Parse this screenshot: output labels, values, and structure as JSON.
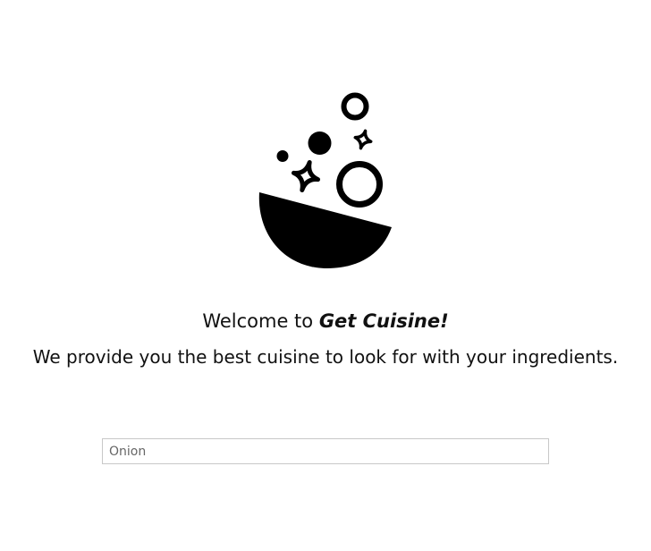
{
  "app": {
    "welcome_prefix": "Welcome to ",
    "brand_name": "Get Cuisine!",
    "tagline": "We provide you the best cuisine to look for with your ingredients."
  },
  "logo": {
    "icon": "cooking-bowl-icon",
    "color": "#000000"
  },
  "search": {
    "placeholder": "Onion",
    "value": ""
  }
}
